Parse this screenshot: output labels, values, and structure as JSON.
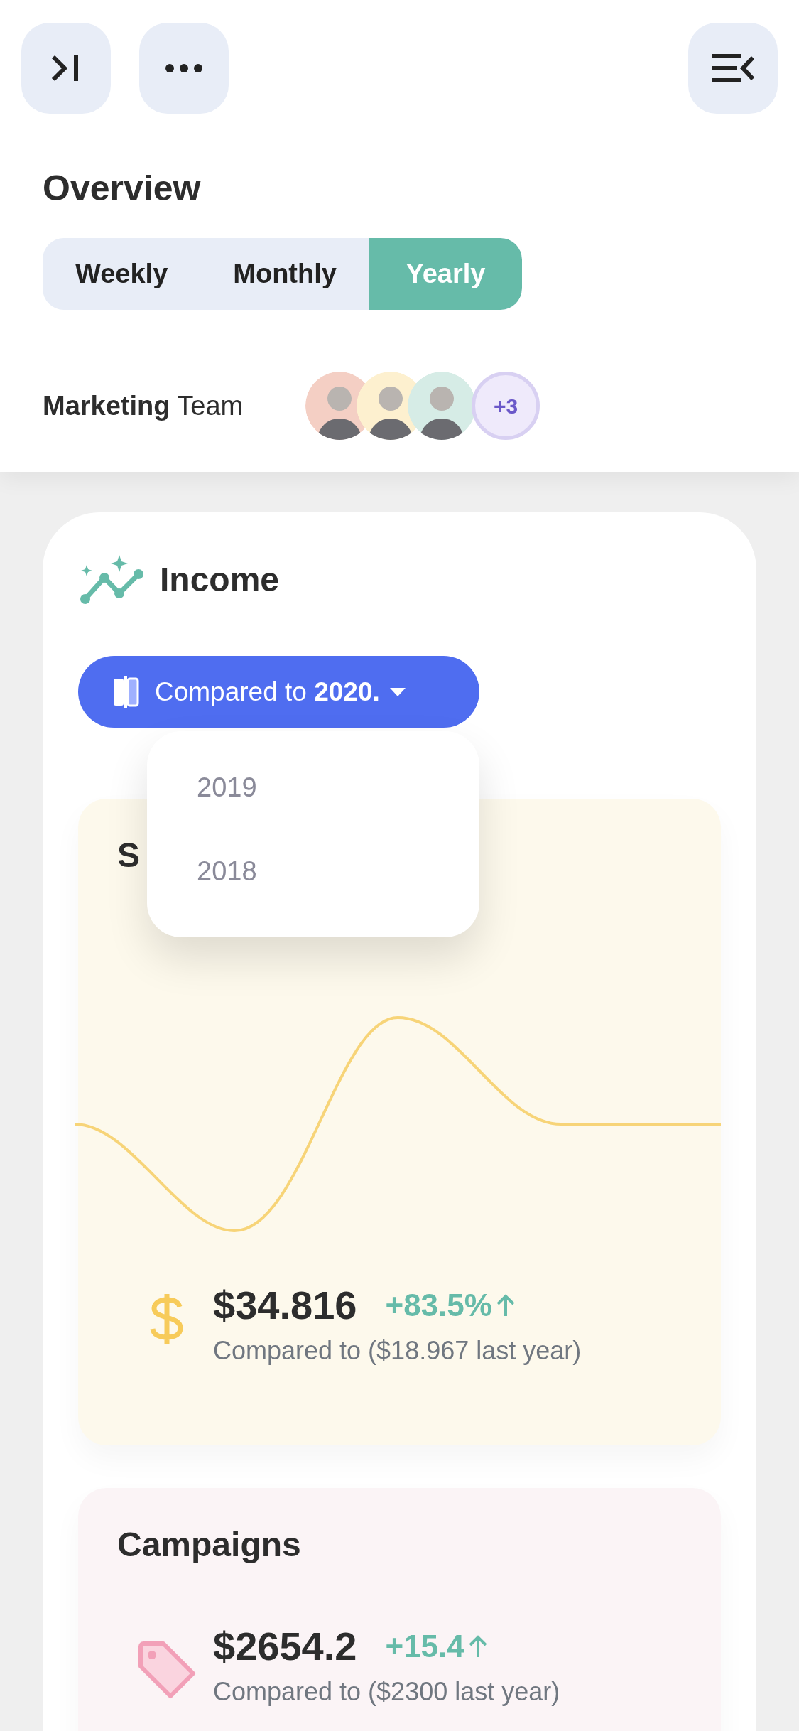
{
  "overview": {
    "title": "Overview",
    "tabs": [
      {
        "label": "Weekly",
        "selected": false
      },
      {
        "label": "Monthly",
        "selected": false
      },
      {
        "label": "Yearly",
        "selected": true
      }
    ],
    "team": "**Marketing** Team",
    "more_count": "+3"
  },
  "income": {
    "title": "Income",
    "compare_button": "Compared to **2020.**",
    "dropdown": {
      "options": [
        "2019",
        "2018"
      ]
    },
    "cards": [
      {
        "kind": "sales",
        "title": "S",
        "value": "$34.816",
        "change": "+83.5%",
        "note": "Compared to ($18.967 last year)"
      },
      {
        "kind": "campaigns",
        "title": "Campaigns",
        "value": "$2654.2",
        "change": "+15.4",
        "note": "Compared to ($2300 last year)"
      }
    ]
  }
}
